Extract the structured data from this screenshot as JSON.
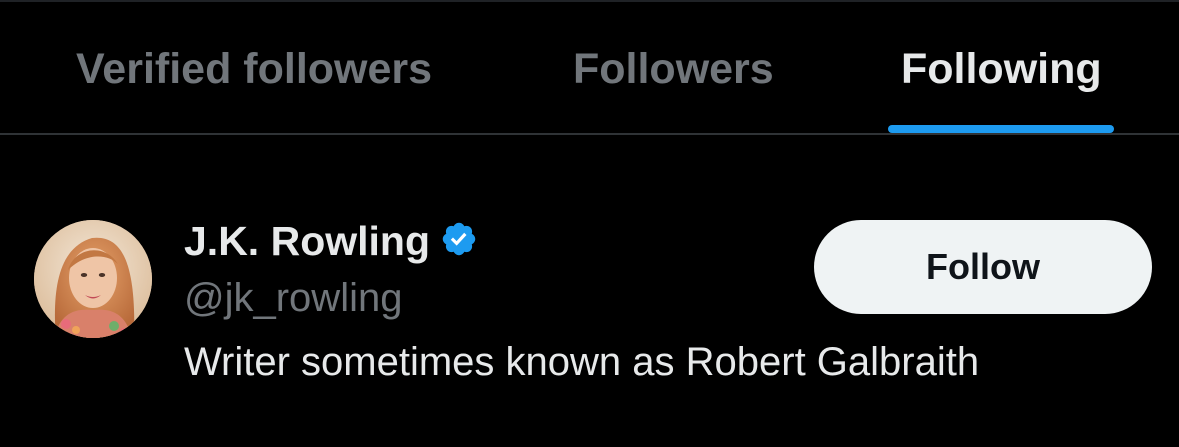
{
  "tabs": [
    {
      "label": "Verified followers",
      "active": false
    },
    {
      "label": "Followers",
      "active": false
    },
    {
      "label": "Following",
      "active": true
    }
  ],
  "user": {
    "display_name": "J.K. Rowling",
    "verified": true,
    "verified_icon": "verified-badge-icon",
    "handle": "@jk_rowling",
    "bio": "Writer sometimes known as Robert Galbraith",
    "follow_label": "Follow"
  },
  "colors": {
    "background": "#000000",
    "text_primary": "#e7e9ea",
    "text_secondary": "#71767b",
    "accent": "#1d9bf0",
    "button_bg": "#eff3f4",
    "button_text": "#0f1419"
  }
}
